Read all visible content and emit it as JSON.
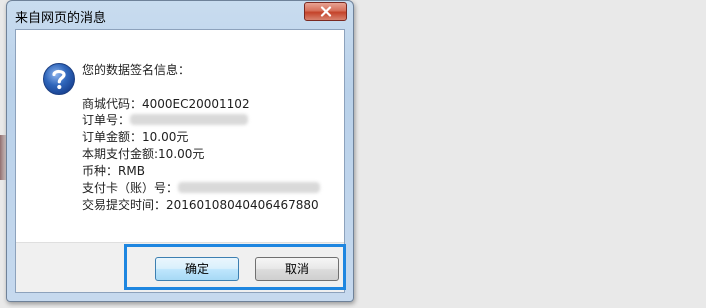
{
  "dialog": {
    "title": "来自网页的消息",
    "heading": "您的数据签名信息：",
    "lines": {
      "merchant_code": "商城代码：4000EC20001102",
      "order_no_label": "订单号：",
      "order_amount": "订单金额：10.00元",
      "pay_amount": "本期支付金额:10.00元",
      "currency": "币种：RMB",
      "card_label": "支付卡（账）号：",
      "submit_time": "交易提交时间：20160108040406467880"
    },
    "ok_label": "确定",
    "cancel_label": "取消"
  },
  "icons": {
    "question": "question-icon",
    "close": "close-icon"
  },
  "colors": {
    "highlight": "#1e86e0",
    "icon_blue": "#2b62b5"
  }
}
